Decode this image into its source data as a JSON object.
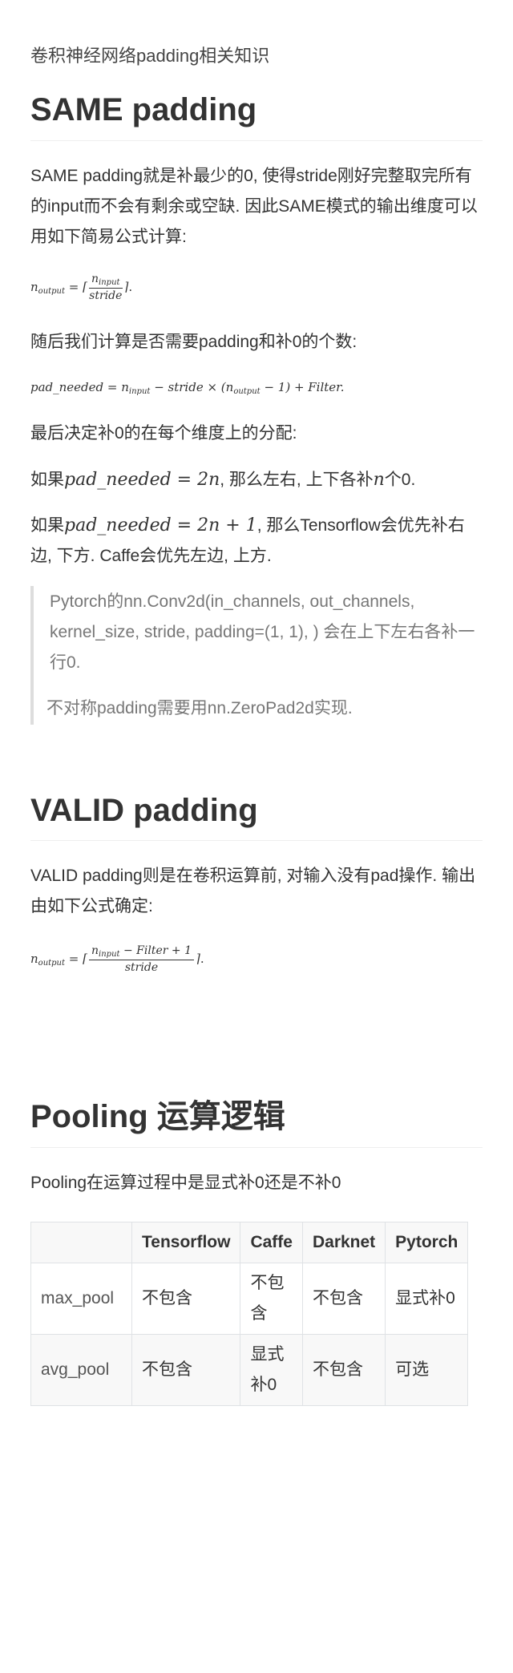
{
  "doc_title": "卷积神经网络padding相关知识",
  "same": {
    "heading": "SAME padding",
    "intro": "SAME padding就是补最少的0, 使得stride刚好完整取完所有的input而不会有剩余或空缺. 因此SAME模式的输出维度可以用如下简易公式计算:",
    "formula1": {
      "lhs": "n",
      "lhs_sub": "output",
      "eq": "=",
      "num": "n",
      "num_sub": "input",
      "den": "stride",
      "tail": "."
    },
    "p2": "随后我们计算是否需要padding和补0的个数:",
    "formula2": {
      "a": "pad_needed = n",
      "a_sub": "input",
      "b": " − stride × (n",
      "b_sub": "output",
      "c": " − 1) + Filter."
    },
    "p3": "最后决定补0的在每个维度上的分配:",
    "p4": {
      "pre": "如果",
      "math": "pad_needed = 2n",
      "post": ", 那么左右, 上下各补",
      "math2": "n",
      "post2": "个0."
    },
    "p5": {
      "pre": "如果",
      "math": "pad_needed = 2n + 1",
      "post": ", 那么Tensorflow会优先补右边, 下方. Caffe会优先左边, 上方."
    },
    "quote": [
      "Pytorch的nn.Conv2d(in_channels, out_channels, kernel_size, stride, padding=(1, 1), ) 会在上下左右各补一行0.",
      "不对称padding需要用nn.ZeroPad2d实现."
    ]
  },
  "valid": {
    "heading": "VALID padding",
    "intro": "VALID padding则是在卷积运算前, 对输入没有pad操作. 输出由如下公式确定:",
    "formula": {
      "lhs": "n",
      "lhs_sub": "output",
      "eq": "=",
      "num": "n",
      "num_sub": "input",
      "num_rest": " − Filter + 1",
      "den": "stride",
      "tail": "."
    }
  },
  "pooling": {
    "heading": "Pooling 运算逻辑",
    "intro": "Pooling在运算过程中是显式补0还是不补0",
    "table": {
      "headers": [
        "",
        "Tensorflow",
        "Caffe",
        "Darknet",
        "Pytorch"
      ],
      "rows": [
        [
          "max_pool",
          "不包含",
          "不包含",
          "不包含",
          "显式补0"
        ],
        [
          "avg_pool",
          "不包含",
          "显式补0",
          "不包含",
          "可选"
        ]
      ]
    }
  }
}
